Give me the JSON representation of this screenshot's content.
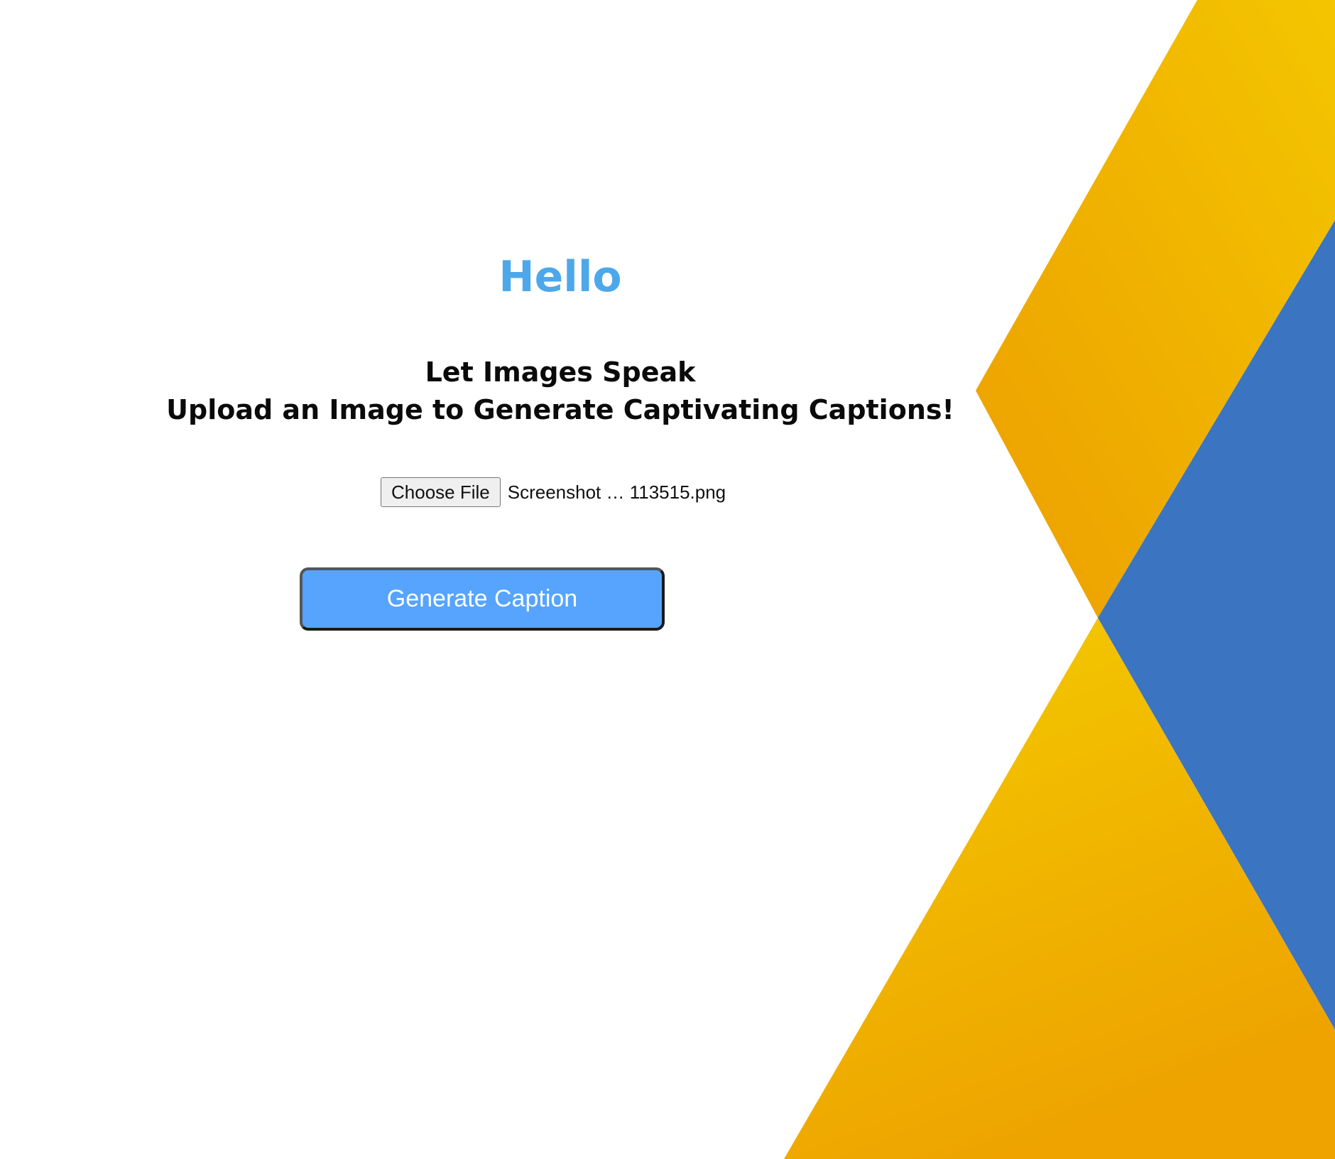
{
  "page": {
    "greeting": "Hello",
    "tagline_line1": "Let Images Speak",
    "tagline_line2": "Upload an Image to Generate Captivating Captions!"
  },
  "file_input": {
    "button_label": "Choose File",
    "selected_file": "Screenshot … 113515.png"
  },
  "actions": {
    "generate_label": "Generate Caption"
  },
  "colors": {
    "greeting": "#4da8ea",
    "generate_button": "#56a4fe",
    "background_yellow": "#f2b400",
    "background_orange": "#eea000",
    "background_blue": "#3b74c1"
  }
}
